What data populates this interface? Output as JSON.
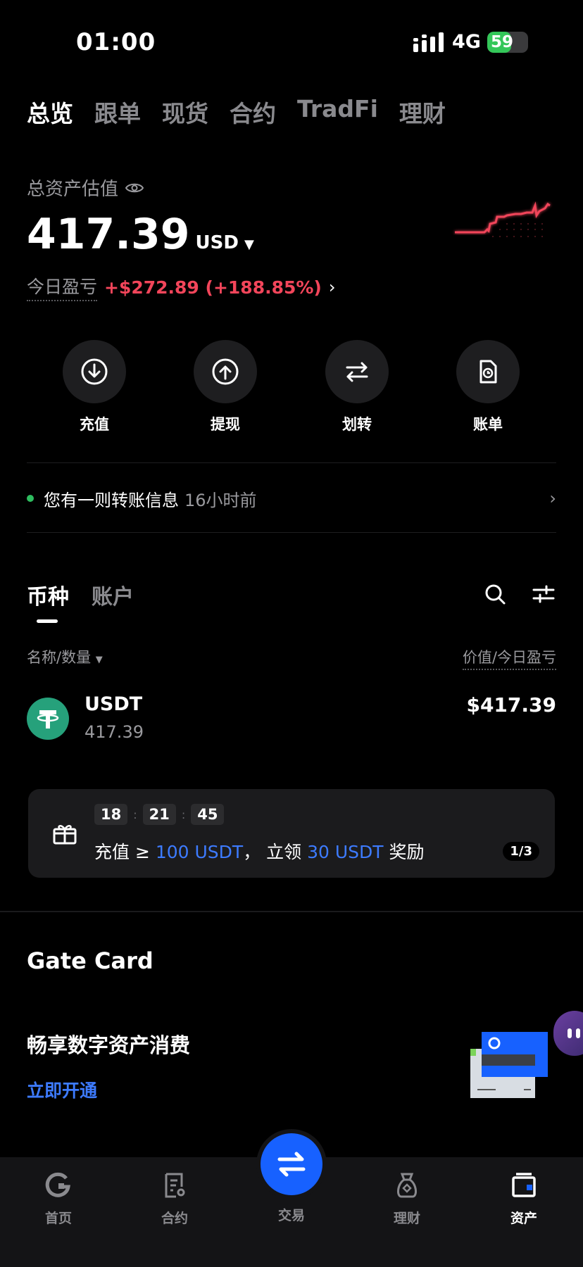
{
  "status_bar": {
    "time": "01:00",
    "network": "4G",
    "battery": "59",
    "battery_level": 0.59
  },
  "top_tabs": [
    {
      "label": "总览",
      "active": true
    },
    {
      "label": "跟单",
      "active": false
    },
    {
      "label": "现货",
      "active": false
    },
    {
      "label": "合约",
      "active": false
    },
    {
      "label": "TradFi",
      "active": false
    },
    {
      "label": "理财",
      "active": false
    }
  ],
  "overview": {
    "asset_label": "总资产估值",
    "total_value": "417.39",
    "currency": "USD",
    "pnl_label": "今日盈亏",
    "pnl_value": "+$272.89 (+188.85%)"
  },
  "colors": {
    "accent": "#1761ff",
    "link": "#3d7bff",
    "loss_red": "#f2455a",
    "online_green": "#2ebd5f",
    "usdt_green": "#26a17b"
  },
  "actions": [
    {
      "label": "充值",
      "icon": "deposit-icon"
    },
    {
      "label": "提现",
      "icon": "withdraw-icon"
    },
    {
      "label": "划转",
      "icon": "transfer-icon"
    },
    {
      "label": "账单",
      "icon": "bill-icon"
    }
  ],
  "notice": {
    "text": "您有一则转账信息",
    "time": "16小时前"
  },
  "asset_tabs": [
    {
      "label": "币种",
      "active": true
    },
    {
      "label": "账户",
      "active": false
    }
  ],
  "list_header": {
    "left": "名称/数量",
    "right": "价值/今日盈亏"
  },
  "coins": [
    {
      "symbol": "USDT",
      "amount": "417.39",
      "value": "$417.39"
    }
  ],
  "promo": {
    "countdown": [
      "18",
      "21",
      "45"
    ],
    "text_1": "充值 ≥ ",
    "hl_1": "100 USDT",
    "text_2": "， 立领 ",
    "hl_2": "30 USDT",
    "text_3": " 奖励",
    "page": "1/3"
  },
  "gate_card": {
    "title": "Gate Card",
    "subtitle": "畅享数字资产消费",
    "link": "立即开通"
  },
  "bottom_nav": [
    {
      "label": "首页",
      "icon": "home-icon",
      "active": false
    },
    {
      "label": "合约",
      "icon": "futures-icon",
      "active": false
    },
    {
      "label": "交易",
      "icon": "trade-icon",
      "active": false
    },
    {
      "label": "理财",
      "icon": "earn-icon",
      "active": false
    },
    {
      "label": "资产",
      "icon": "wallet-icon",
      "active": true
    }
  ]
}
